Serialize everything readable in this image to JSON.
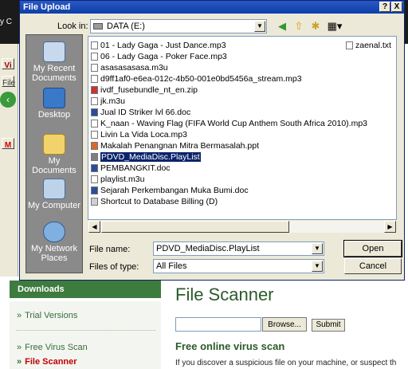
{
  "dialog": {
    "title": "File Upload",
    "help_glyph": "?",
    "close_glyph": "X",
    "look_in_label": "Look in:",
    "look_in_value": "DATA (E:)",
    "file_name_label": "File name:",
    "file_name_value": "PDVD_MediaDisc.PlayList",
    "files_of_type_label": "Files of type:",
    "files_of_type_value": "All Files",
    "open_label": "Open",
    "cancel_label": "Cancel"
  },
  "places": [
    {
      "label": "My Recent Documents"
    },
    {
      "label": "Desktop"
    },
    {
      "label": "My Documents"
    },
    {
      "label": "My Computer"
    },
    {
      "label": "My Network Places"
    }
  ],
  "files": [
    {
      "name": "01 - Lady Gaga - Just Dance.mp3"
    },
    {
      "name": "06 - Lady Gaga - Poker Face.mp3"
    },
    {
      "name": "asasasasasa.m3u"
    },
    {
      "name": "d9ff1af0-e6ea-012c-4b50-001e0bd5456a_stream.mp3"
    },
    {
      "name": "ivdf_fusebundle_nt_en.zip"
    },
    {
      "name": "jk.m3u"
    },
    {
      "name": "Jual ID Striker lvl 66.doc"
    },
    {
      "name": "K_naan - Waving Flag (FIFA World Cup Anthem South Africa 2010).mp3"
    },
    {
      "name": "Livin La Vida Loca.mp3"
    },
    {
      "name": "Makalah Penangnan Mitra Bermasalah.ppt"
    },
    {
      "name": "PDVD_MediaDisc.PlayList",
      "selected": true
    },
    {
      "name": "PEMBANGKIT.doc"
    },
    {
      "name": "playlist.m3u"
    },
    {
      "name": "Sejarah Perkembangan Muka Bumi.doc"
    },
    {
      "name": "Shortcut to Database Billing (D)"
    }
  ],
  "files_col2": [
    {
      "name": "zaenal.txt"
    }
  ],
  "page": {
    "downloads_heading": "Downloads",
    "link_trial": "Trial Versions",
    "link_free_scan": "Free Virus Scan",
    "link_file_scanner": "File Scanner",
    "title": "File Scanner",
    "browse_label": "Browse...",
    "submit_label": "Submit",
    "subtitle": "Free online virus scan",
    "body_text": "If you discover a suspicious file on your machine, or suspect th"
  },
  "browser_fragments": {
    "menu_file": "File",
    "mail_letter": "M",
    "tab_v": "Vi",
    "top_c": "y C"
  },
  "colors": {
    "titlebar": "#0d3fa8",
    "selection": "#0a246a",
    "page_green": "#3e7b3e"
  }
}
